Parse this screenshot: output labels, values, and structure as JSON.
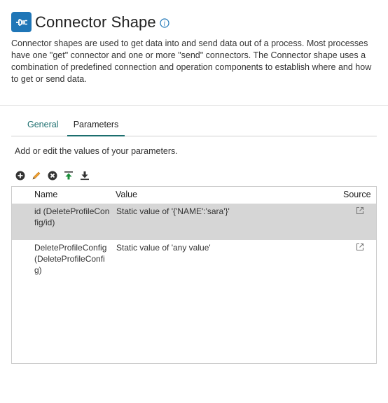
{
  "header": {
    "title": "Connector Shape"
  },
  "description": "Connector shapes are used to get data into and send data out of a process. Most processes have one \"get\" connector and one or more \"send\" connectors. The Connector shape uses a combination of predefined connection and operation components to establish where and how to get or send data.",
  "tabs": [
    {
      "label": "General",
      "active": false
    },
    {
      "label": "Parameters",
      "active": true
    }
  ],
  "hint": "Add or edit the values of your parameters.",
  "toolbar": {
    "icons": [
      "add-icon",
      "edit-icon",
      "delete-icon",
      "move-up-icon",
      "move-down-icon"
    ]
  },
  "grid": {
    "columns": {
      "name": "Name",
      "value": "Value",
      "source": "Source"
    },
    "rows": [
      {
        "name": "id (DeleteProfileConfig/id)",
        "value": "Static value of '{'NAME':'sara'}'",
        "selected": true
      },
      {
        "name": "DeleteProfileConfig (DeleteProfileConfig)",
        "value": "Static value of 'any value'",
        "selected": false
      }
    ]
  },
  "colors": {
    "accent": "#1f76b7",
    "tab_accent": "#1c6e6e",
    "selected_row": "#d6d6d6"
  }
}
